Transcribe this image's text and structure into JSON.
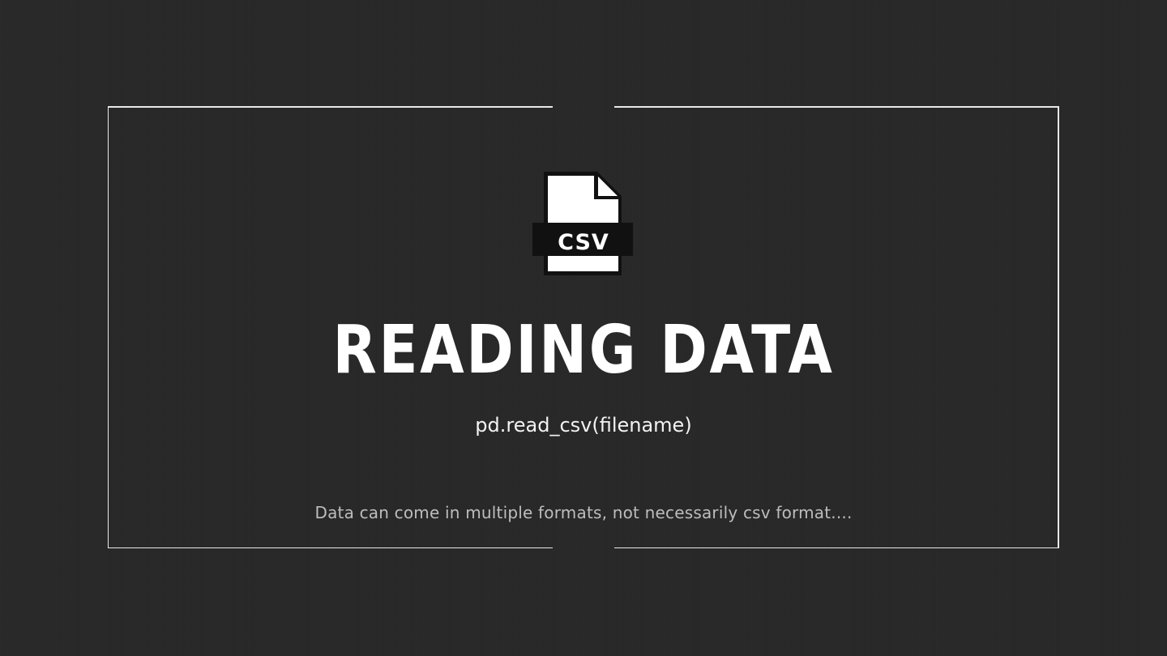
{
  "slide": {
    "icon_name": "csv-file-icon",
    "icon_label": "CSV",
    "title": "READING DATA",
    "code": "pd.read_csv(filename)",
    "caption": "Data can come in multiple formats, not necessarily csv format...."
  },
  "colors": {
    "background": "#282828",
    "frame": "#e8e8e8",
    "text": "#ffffff"
  }
}
